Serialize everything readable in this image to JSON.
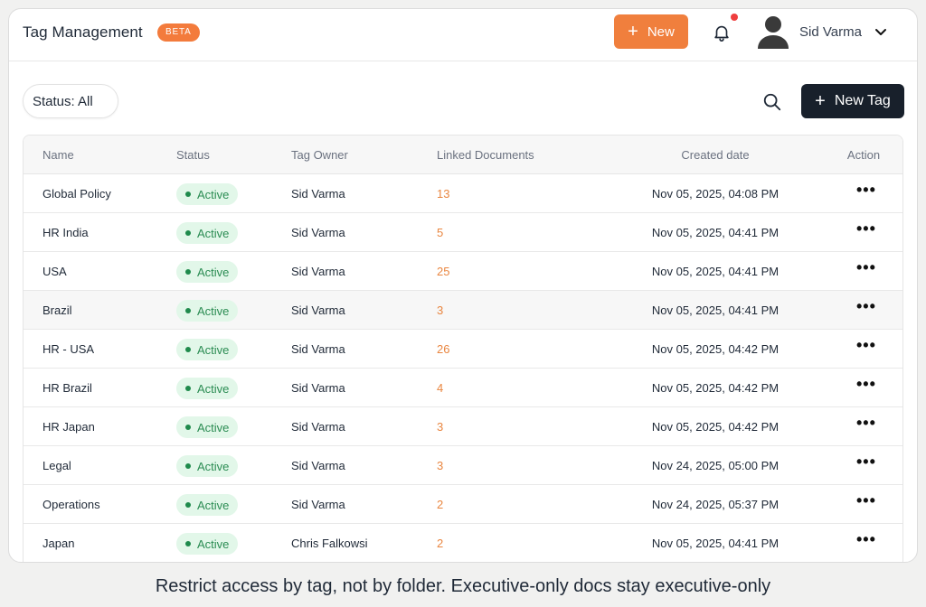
{
  "header": {
    "title": "Tag Management",
    "badge": "BETA",
    "new_button": "New",
    "user_name": "Sid Varma"
  },
  "toolbar": {
    "status_filter": "Status: All",
    "new_tag_button": "New Tag"
  },
  "table": {
    "columns": [
      "Name",
      "Status",
      "Tag Owner",
      "Linked Documents",
      "Created date",
      "Action"
    ],
    "rows": [
      {
        "name": "Global Policy",
        "status": "Active",
        "owner": "Sid Varma",
        "docs": "13",
        "created": "Nov 05, 2025, 04:08 PM"
      },
      {
        "name": "HR India",
        "status": "Active",
        "owner": "Sid Varma",
        "docs": "5",
        "created": "Nov 05, 2025, 04:41 PM"
      },
      {
        "name": "USA",
        "status": "Active",
        "owner": "Sid Varma",
        "docs": "25",
        "created": "Nov 05, 2025, 04:41 PM"
      },
      {
        "name": "Brazil",
        "status": "Active",
        "owner": "Sid Varma",
        "docs": "3",
        "created": "Nov 05, 2025, 04:41 PM"
      },
      {
        "name": "HR - USA",
        "status": "Active",
        "owner": "Sid Varma",
        "docs": "26",
        "created": "Nov 05, 2025, 04:42 PM"
      },
      {
        "name": "HR Brazil",
        "status": "Active",
        "owner": "Sid Varma",
        "docs": "4",
        "created": "Nov 05, 2025, 04:42 PM"
      },
      {
        "name": "HR Japan",
        "status": "Active",
        "owner": "Sid Varma",
        "docs": "3",
        "created": "Nov 05, 2025, 04:42 PM"
      },
      {
        "name": "Legal",
        "status": "Active",
        "owner": "Sid Varma",
        "docs": "3",
        "created": "Nov 24, 2025, 05:00 PM"
      },
      {
        "name": "Operations",
        "status": "Active",
        "owner": "Sid Varma",
        "docs": "2",
        "created": "Nov 24, 2025, 05:37 PM"
      },
      {
        "name": "Japan",
        "status": "Active",
        "owner": "Chris Falkowsi",
        "docs": "2",
        "created": "Nov 05, 2025, 04:41 PM"
      }
    ]
  },
  "caption": "Restrict access by tag, not by folder. Executive-only docs stay executive-only",
  "colors": {
    "accent": "#f07f3d",
    "dark_button": "#18202b",
    "active_bg": "#e2f7e9",
    "active_text": "#2b8c53",
    "notification": "#ef3e3e"
  },
  "icons": {
    "new": "plus-icon",
    "notification": "bell-icon",
    "avatar": "user-avatar-icon",
    "menu": "chevron-down-icon",
    "search": "search-icon",
    "action": "more-horizontal-icon"
  }
}
